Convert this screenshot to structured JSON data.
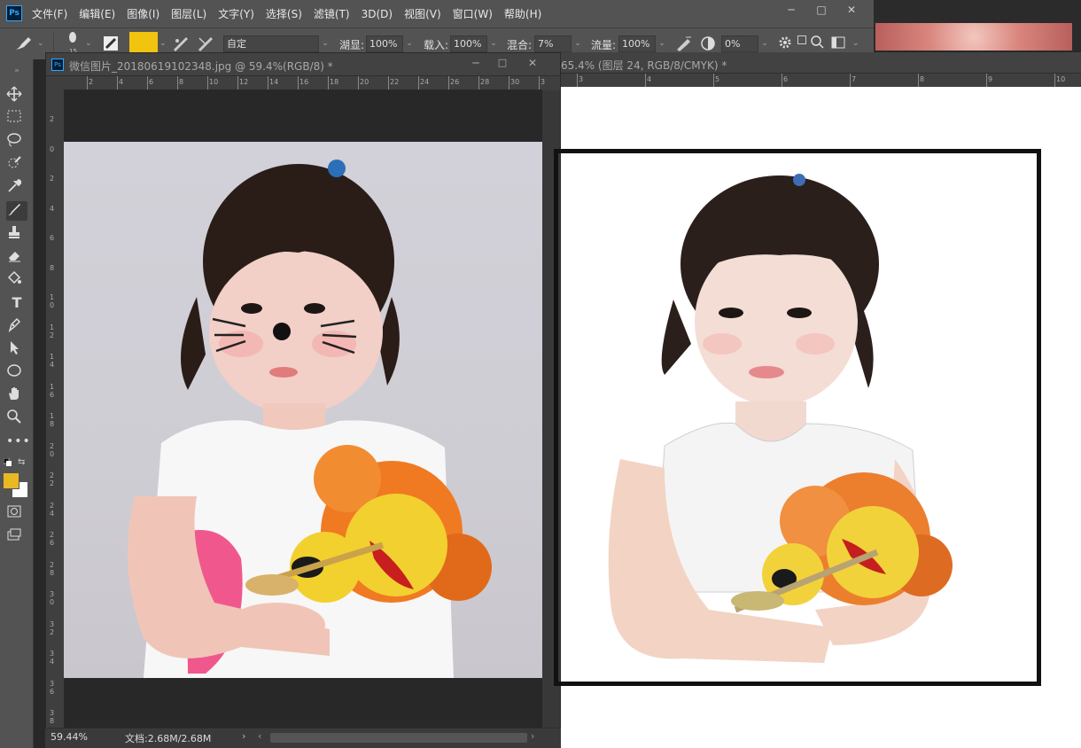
{
  "app": {
    "logo": "Ps",
    "menu": [
      "文件(F)",
      "编辑(E)",
      "图像(I)",
      "图层(L)",
      "文字(Y)",
      "选择(S)",
      "滤镜(T)",
      "3D(D)",
      "视图(V)",
      "窗口(W)",
      "帮助(H)"
    ],
    "window_controls": {
      "minimize": "─",
      "restore": "□",
      "close": "✕"
    }
  },
  "options_bar": {
    "brush_size": "15",
    "preset": "自定",
    "opacity_label": "湖显:",
    "opacity_value": "100%",
    "flow_label": "载入:",
    "flow_value": "100%",
    "mix_label": "混合:",
    "mix_value": "7%",
    "flow2_label": "流量:",
    "flow2_value": "100%",
    "smoothing_value": "0%",
    "foreground_color": "#f1c40f"
  },
  "toolbox": {
    "tools": [
      "move-icon",
      "marquee-icon",
      "lasso-icon",
      "quick-select-icon",
      "eyedropper-icon",
      "brush-icon",
      "stamp-icon",
      "eraser-icon",
      "paint-bucket-icon",
      "type-icon",
      "pen-icon",
      "path-select-icon",
      "ellipse-icon",
      "hand-icon",
      "zoom-icon",
      "more-icon"
    ],
    "foreground_color": "#e8b923",
    "background_color": "#ffffff"
  },
  "doc1": {
    "title": "微信图片_20180619102348.jpg @ 59.4%(RGB/8) *",
    "ruler_top": [
      "2",
      "4",
      "6",
      "8",
      "10",
      "12",
      "14",
      "16",
      "18",
      "20",
      "22",
      "24",
      "26",
      "28",
      "30",
      "3"
    ],
    "ruler_left": [
      "2",
      "0",
      "2",
      "4",
      "6",
      "8",
      "10",
      "12",
      "14",
      "16",
      "18",
      "20",
      "22",
      "24",
      "26",
      "28",
      "30",
      "32",
      "34",
      "36",
      "38"
    ],
    "status_zoom": "59.44%",
    "status_doc": "文档:2.68M/2.68M"
  },
  "doc2": {
    "title": "65.4% (图层 24, RGB/8/CMYK) *",
    "ruler_top": [
      "3",
      "4",
      "5",
      "6",
      "7",
      "8",
      "9",
      "10"
    ]
  }
}
